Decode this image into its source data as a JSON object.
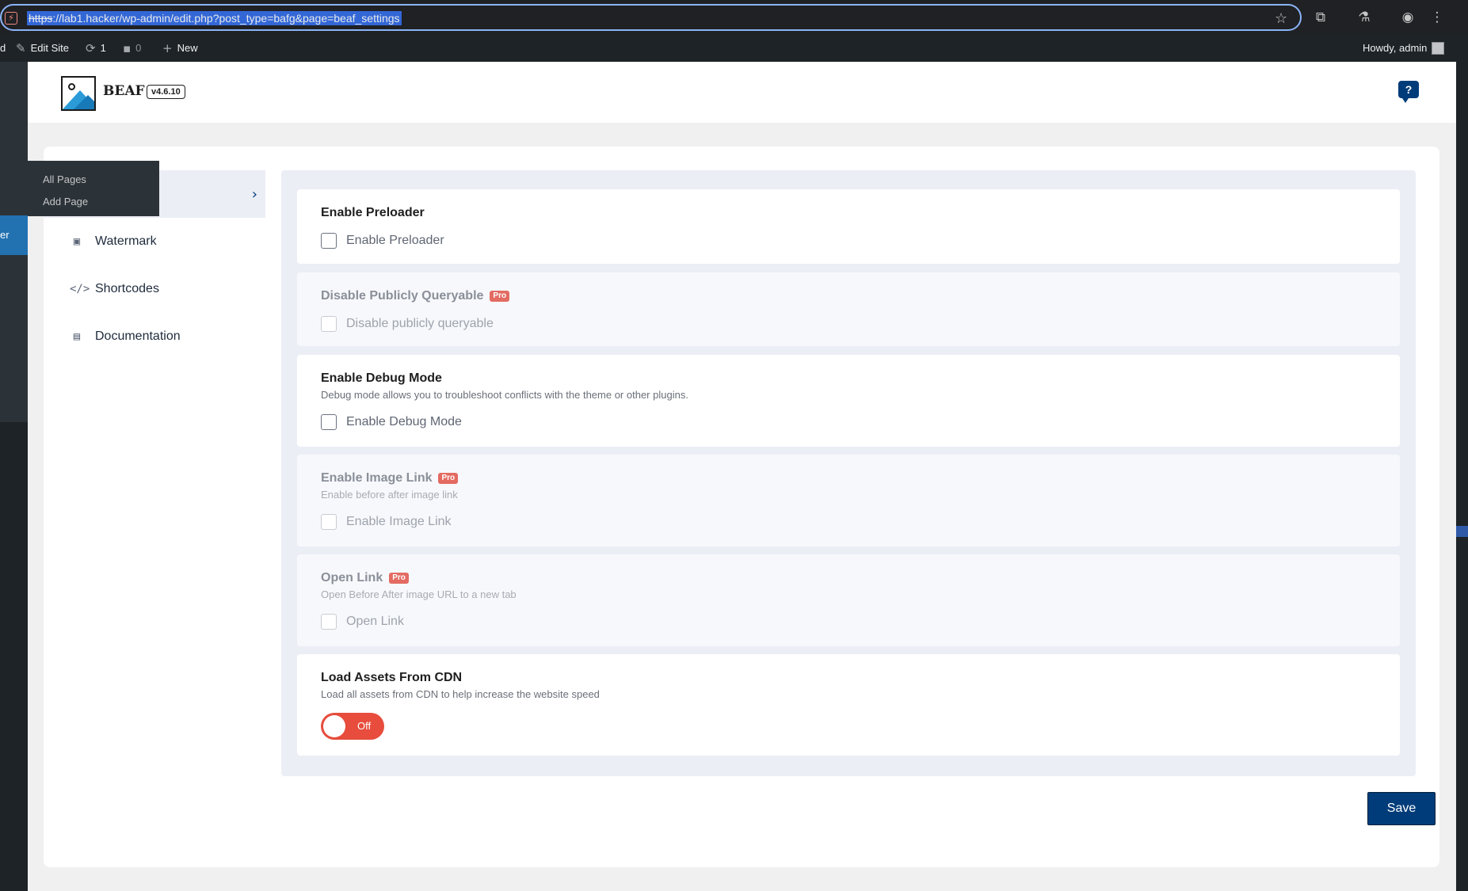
{
  "browser": {
    "url_scheme": "https",
    "url_rest": "://lab1.hacker/wp-admin/edit.php?post_type=bafg&page=beaf_settings",
    "site_icon": "shield-warning-icon",
    "toolbar_icons": [
      "star-icon",
      "extensions-icon",
      "labs-flask-icon",
      "profile-icon",
      "kebab-menu-icon"
    ]
  },
  "adminbar": {
    "left_fragment": "d",
    "edit_site": "Edit Site",
    "updates_count": "1",
    "comments_count": "0",
    "new_label": "New",
    "howdy": "Howdy, admin"
  },
  "wp_menu": {
    "current_fragment": "er",
    "flyout": [
      "All Pages",
      "Add Page"
    ]
  },
  "plugin": {
    "name": "BEAF",
    "version": "v4.6.10",
    "help": "?"
  },
  "nav": {
    "items": [
      {
        "label": "Watermark",
        "icon": "image-icon",
        "glyph": "▣"
      },
      {
        "label": "Shortcodes",
        "icon": "code-icon",
        "glyph": "</>"
      },
      {
        "label": "Documentation",
        "icon": "document-icon",
        "glyph": "▤"
      }
    ]
  },
  "fields": {
    "preloader": {
      "title": "Enable Preloader",
      "check_label": "Enable Preloader"
    },
    "queryable": {
      "title": "Disable Publicly Queryable",
      "badge": "Pro",
      "check_label": "Disable publicly queryable"
    },
    "debug": {
      "title": "Enable Debug Mode",
      "desc": "Debug mode allows you to troubleshoot conflicts with the theme or other plugins.",
      "check_label": "Enable Debug Mode"
    },
    "image_link": {
      "title": "Enable Image Link",
      "badge": "Pro",
      "desc": "Enable before after image link",
      "check_label": "Enable Image Link"
    },
    "open_link": {
      "title": "Open Link",
      "badge": "Pro",
      "desc": "Open Before After image URL to a new tab",
      "check_label": "Open Link"
    },
    "cdn": {
      "title": "Load Assets From CDN",
      "desc": "Load all assets from CDN to help increase the website speed",
      "toggle_label": "Off",
      "toggle_on": false
    }
  },
  "save_label": "Save",
  "colors": {
    "primary": "#003c79",
    "toggle_off": "#e74c3c",
    "pro_badge": "#e36b62",
    "wp_current": "#2271b1"
  }
}
